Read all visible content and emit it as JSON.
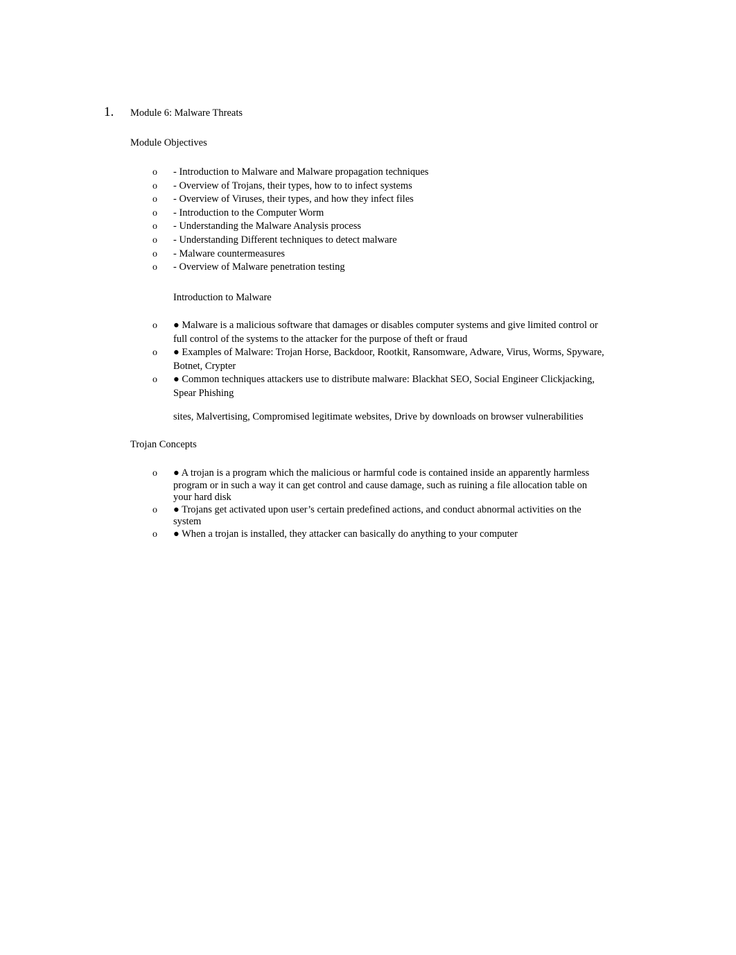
{
  "document": {
    "list_marker": "1.",
    "title": "Module 6: Malware Threats",
    "objectives_heading": "Module Objectives",
    "objectives_marker": "o",
    "objectives": [
      "- Introduction to Malware and Malware propagation techniques",
      "- Overview of Trojans, their types, how to to infect systems",
      "- Overview of Viruses, their types, and how they infect files",
      "- Introduction to the Computer Worm",
      "- Understanding the Malware Analysis process",
      "- Understanding Different techniques to detect malware",
      "- Malware countermeasures",
      "- Overview of Malware penetration testing"
    ],
    "intro_heading": "Introduction to Malware",
    "intro_bullets": [
      "● Malware is a malicious software that damages or disables computer systems and give limited control or full control of the systems to the attacker for the purpose of theft or fraud",
      "● Examples of Malware: Trojan Horse, Backdoor, Rootkit, Ransomware, Adware, Virus, Worms, Spyware, Botnet, Crypter",
      "● Common techniques attackers use to distribute malware: Blackhat SEO, Social Engineer Clickjacking, Spear Phishing"
    ],
    "intro_trailing_paragraph": "sites, Malvertising, Compromised legitimate websites, Drive by downloads on browser vulnerabilities",
    "trojan_heading": "Trojan Concepts",
    "trojan_bullets": [
      "● A trojan is a program which the malicious or harmful code is contained inside an apparently harmless program or in such a way it can get control and cause damage, such as ruining a file allocation table on your hard disk",
      "● Trojans get activated upon user’s certain predefined actions, and conduct abnormal activities on the system",
      "● When a trojan is installed, they attacker can basically do anything to your computer"
    ]
  }
}
